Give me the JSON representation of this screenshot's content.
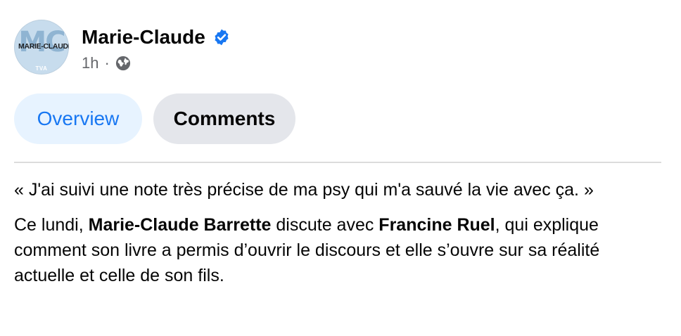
{
  "post": {
    "avatar": {
      "monogram": "MC",
      "name": "MARIE-CLAUDE",
      "network": "TVA"
    },
    "page_name": "Marie-Claude",
    "verified_icon": "verified-badge-icon",
    "time": "1h",
    "separator": "·",
    "audience_icon": "globe-icon"
  },
  "tabs": [
    {
      "label": "Overview",
      "active": true
    },
    {
      "label": "Comments",
      "active": false
    }
  ],
  "body": {
    "quote": "« J'ai suivi une note très précise de ma psy qui m'a sauvé la vie avec ça. »",
    "p2_start": "Ce lundi, ",
    "p2_name1": "Marie-Claude Barrette",
    "p2_mid": " discute avec ",
    "p2_name2": "Francine Ruel",
    "p2_end": ", qui explique comment son livre a permis d’ouvrir le discours et elle s’ouvre sur sa réalité actuelle et celle de son fils."
  },
  "colors": {
    "accent": "#1877f2",
    "active_tab_bg": "#e7f3ff",
    "inactive_tab_bg": "#e4e6eb",
    "secondary_text": "#65676b"
  }
}
